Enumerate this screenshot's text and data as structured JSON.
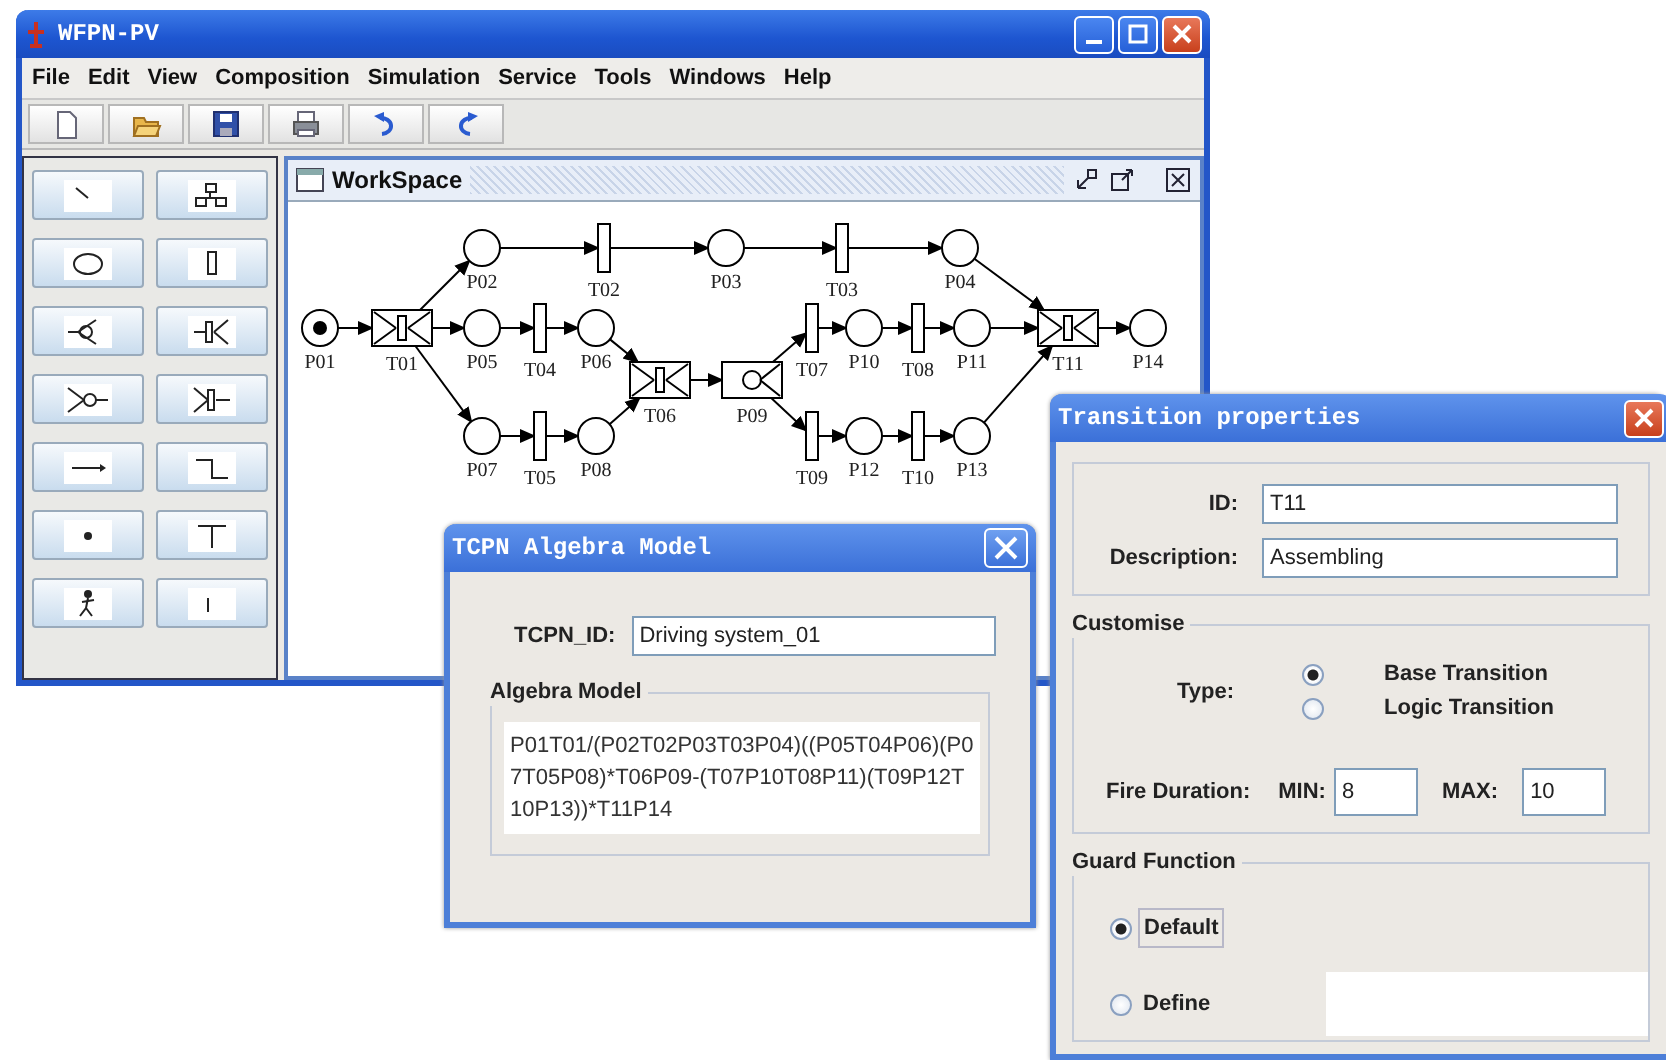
{
  "window": {
    "title": "WFPN-PV"
  },
  "menu": [
    "File",
    "Edit",
    "View",
    "Composition",
    "Simulation",
    "Service",
    "Tools",
    "Windows",
    "Help"
  ],
  "workspace": {
    "title": "WorkSpace",
    "nodes": [
      {
        "label": "P01",
        "kind": "place",
        "marked": true
      },
      {
        "label": "T01",
        "kind": "composite-transition",
        "marked": false
      },
      {
        "label": "P02",
        "kind": "place",
        "marked": false
      },
      {
        "label": "T02",
        "kind": "transition",
        "marked": false
      },
      {
        "label": "P03",
        "kind": "place",
        "marked": false
      },
      {
        "label": "T03",
        "kind": "transition",
        "marked": false
      },
      {
        "label": "P04",
        "kind": "place",
        "marked": false
      },
      {
        "label": "P05",
        "kind": "place",
        "marked": false
      },
      {
        "label": "T04",
        "kind": "transition",
        "marked": false
      },
      {
        "label": "P06",
        "kind": "place",
        "marked": false
      },
      {
        "label": "T06",
        "kind": "composite-transition",
        "marked": false
      },
      {
        "label": "P09",
        "kind": "composite-place",
        "marked": false
      },
      {
        "label": "T07",
        "kind": "transition",
        "marked": false
      },
      {
        "label": "P10",
        "kind": "place",
        "marked": false
      },
      {
        "label": "T08",
        "kind": "transition",
        "marked": false
      },
      {
        "label": "P11",
        "kind": "place",
        "marked": false
      },
      {
        "label": "T11",
        "kind": "composite-transition",
        "marked": false
      },
      {
        "label": "P14",
        "kind": "place",
        "marked": false
      },
      {
        "label": "P07",
        "kind": "place",
        "marked": false
      },
      {
        "label": "T05",
        "kind": "transition",
        "marked": false
      },
      {
        "label": "P08",
        "kind": "place",
        "marked": false
      },
      {
        "label": "T09",
        "kind": "transition",
        "marked": false
      },
      {
        "label": "P12",
        "kind": "place",
        "marked": false
      },
      {
        "label": "T10",
        "kind": "transition",
        "marked": false
      },
      {
        "label": "P13",
        "kind": "place",
        "marked": false
      }
    ]
  },
  "algebra_dialog": {
    "title": "TCPN Algebra Model",
    "id_label": "TCPN_ID:",
    "id_value": "Driving system_01",
    "group_title": "Algebra Model",
    "model_text": "P01T01/(P02T02P03T03P04)((P05T04P06)(P07T05P08)*T06P09-(T07P10T08P11)(T09P12T10P13))*T11P14"
  },
  "transition_dialog": {
    "title": "Transition properties",
    "id_label": "ID:",
    "id_value": "T11",
    "description_label": "Description:",
    "description_value": "Assembling",
    "customise_title": "Customise",
    "type_label": "Type:",
    "types": [
      {
        "label": "Base Transition",
        "selected": true
      },
      {
        "label": "Logic Transition",
        "selected": false
      }
    ],
    "fire_duration_label": "Fire Duration:",
    "min_label": "MIN:",
    "min_value": "8",
    "max_label": "MAX:",
    "max_value": "10",
    "guard_title": "Guard Function",
    "guards": [
      {
        "label": "Default",
        "selected": true
      },
      {
        "label": "Define",
        "selected": false
      }
    ]
  }
}
